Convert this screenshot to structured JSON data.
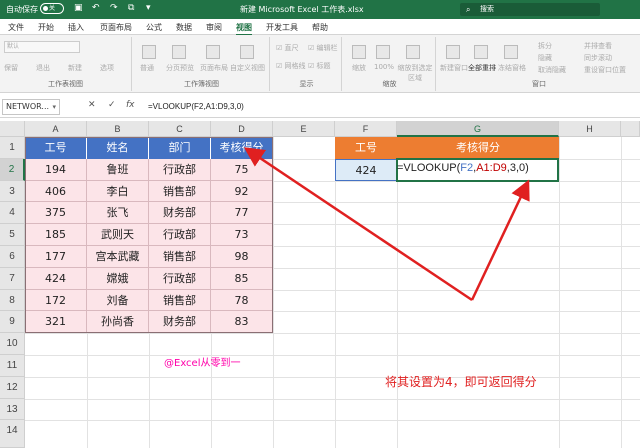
{
  "titlebar": {
    "autosave_label": "自动保存",
    "autosave_state": "关",
    "doc_title": "新建 Microsoft Excel 工作表.xlsx",
    "search_placeholder": "搜索",
    "quick_access_icons": [
      "save-icon",
      "undo-icon",
      "redo-icon",
      "copy-icon",
      "dropdown-icon"
    ]
  },
  "menu": {
    "tabs": [
      "文件",
      "开始",
      "插入",
      "页面布局",
      "公式",
      "数据",
      "审阅",
      "视图",
      "开发工具",
      "帮助"
    ],
    "active_tab": "视图"
  },
  "ribbon": {
    "groups": [
      {
        "label": "工作表视图",
        "items": [
          "默认",
          "保留",
          "退出",
          "新建",
          "选项"
        ]
      },
      {
        "label": "工作簿视图",
        "items": [
          "普通",
          "分页预览",
          "页面布局",
          "自定义视图"
        ]
      },
      {
        "label": "显示",
        "items": [
          "直尺",
          "编辑栏",
          "网格线",
          "标题"
        ]
      },
      {
        "label": "缩放",
        "items": [
          "缩放",
          "100%",
          "缩放到选定区域"
        ]
      },
      {
        "label": "窗口",
        "items": [
          "新建窗口",
          "全部重排",
          "冻结窗格",
          "拆分",
          "隐藏",
          "取消隐藏",
          "并排查看",
          "同步滚动",
          "重设窗口位置"
        ]
      }
    ]
  },
  "formula_bar": {
    "name_box": "NETWOR...",
    "cancel_symbol": "✕",
    "enter_symbol": "✓",
    "fx_symbol": "fx",
    "formula": "=VLOOKUP(F2,A1:D9,3,0)"
  },
  "columns": [
    "A",
    "B",
    "C",
    "D",
    "E",
    "F",
    "G",
    "H"
  ],
  "rows": [
    "1",
    "2",
    "3",
    "4",
    "5",
    "6",
    "7",
    "8",
    "9",
    "10",
    "11",
    "12",
    "13",
    "14"
  ],
  "table": {
    "headers": [
      "工号",
      "姓名",
      "部门",
      "考核得分"
    ],
    "rows": [
      [
        "194",
        "鲁班",
        "行政部",
        "75"
      ],
      [
        "406",
        "李白",
        "销售部",
        "92"
      ],
      [
        "375",
        "张飞",
        "财务部",
        "77"
      ],
      [
        "185",
        "武则天",
        "行政部",
        "73"
      ],
      [
        "177",
        "宫本武藏",
        "销售部",
        "98"
      ],
      [
        "424",
        "嫦娥",
        "行政部",
        "85"
      ],
      [
        "172",
        "刘备",
        "销售部",
        "78"
      ],
      [
        "321",
        "孙尚香",
        "财务部",
        "83"
      ]
    ]
  },
  "lookup": {
    "header_f": "工号",
    "header_g": "考核得分",
    "value_f": "424",
    "formula_parts": {
      "prefix": "=VLOOKUP(",
      "ref1": "F2",
      "comma1": ",",
      "ref2": "A1:D9",
      "suffix": ",3,0)"
    }
  },
  "annotations": {
    "watermark": "@Excel从零到一",
    "note": "将其设置为4，即可返回得分"
  },
  "colors": {
    "excel_green": "#217346",
    "table_header": "#4472c4",
    "table_body": "#fce4e8",
    "orange_header": "#ed7d31",
    "arrow_red": "#e02020"
  }
}
